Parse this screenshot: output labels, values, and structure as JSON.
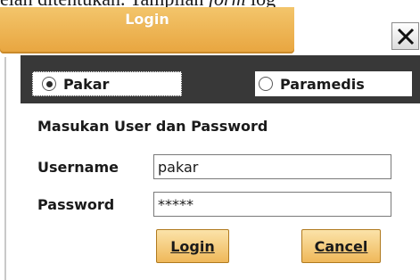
{
  "background_text": {
    "prefix": "elah ditentukan. Tampilan ",
    "italic": "form",
    "suffix": " log"
  },
  "window": {
    "title": "Login",
    "close_icon": "close-x-icon"
  },
  "roles": {
    "pakar_label": "Pakar",
    "paramedis_label": "Paramedis",
    "selected": "Pakar"
  },
  "credentials": {
    "heading": "Masukan User dan Password",
    "username_label": "Username",
    "username_value": "pakar",
    "password_label": "Password",
    "password_value": "*****"
  },
  "buttons": {
    "login": "Login",
    "cancel": "Cancel"
  },
  "colors": {
    "title_tab": "#e8a53f",
    "role_bar": "#383838",
    "button": "#efb85a"
  }
}
